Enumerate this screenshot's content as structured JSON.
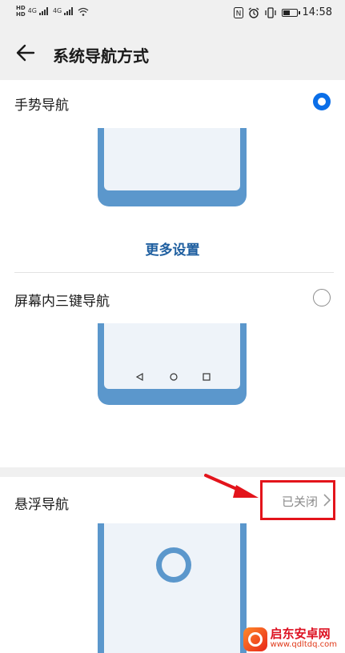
{
  "status_bar": {
    "sim1": "HD",
    "sim1_sub": "B",
    "net1": "4G",
    "net2": "4G",
    "time": "14:58",
    "battery_level": 0.55
  },
  "header": {
    "title": "系统导航方式"
  },
  "options": {
    "gesture": {
      "label": "手势导航",
      "selected": true,
      "more_label": "更多设置"
    },
    "three_key": {
      "label": "屏幕内三键导航",
      "selected": false
    },
    "floating": {
      "label": "悬浮导航",
      "status": "已关闭"
    }
  },
  "watermark": {
    "title": "启东安卓网",
    "url": "www.qdltdq.com"
  },
  "colors": {
    "accent": "#0a6ee8",
    "link": "#1f5fa0",
    "illustration": "#5b97cc",
    "annotation": "#e3141b"
  }
}
